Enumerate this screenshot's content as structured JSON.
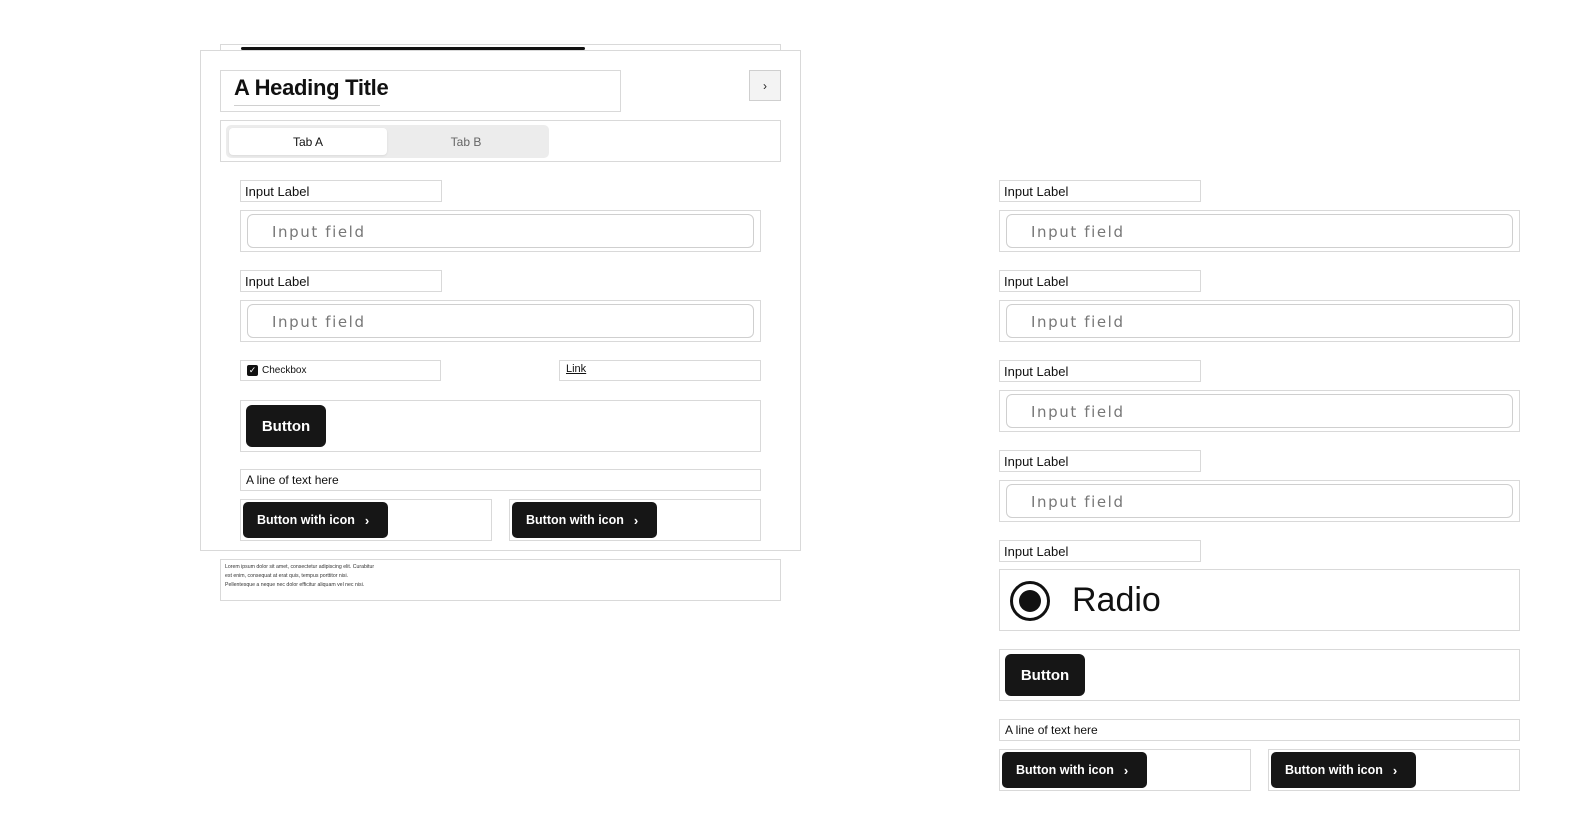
{
  "left_panel": {
    "heading": "A Heading Title",
    "chevron_glyph": "›",
    "tabs": [
      {
        "label": "Tab A",
        "active": true
      },
      {
        "label": "Tab B",
        "active": false
      }
    ],
    "inputs": [
      {
        "label": "Input Label",
        "placeholder": "Input field"
      },
      {
        "label": "Input Label",
        "placeholder": "Input field"
      }
    ],
    "checkbox": {
      "label": "Checkbox",
      "checked": true
    },
    "link": "Link",
    "button": "Button",
    "text_line": "A line of text here",
    "icon_buttons": [
      {
        "label": "Button with icon",
        "icon": "chevron-right-icon"
      },
      {
        "label": "Button with icon",
        "icon": "chevron-right-icon"
      }
    ],
    "lorem": "Lorem ipsum dolor sit amet, consectetur adipiscing elit. Curabitur est enim, consequat at erat quis, tempus porttitor nisi. Pellentesque a neque nec dolor efficitur aliquam vel nec nisi."
  },
  "right_panel": {
    "inputs": [
      {
        "label": "Input Label",
        "placeholder": "Input field"
      },
      {
        "label": "Input Label",
        "placeholder": "Input field"
      },
      {
        "label": "Input Label",
        "placeholder": "Input field"
      },
      {
        "label": "Input Label",
        "placeholder": "Input field"
      }
    ],
    "radio_label_heading": "Input Label",
    "radio": {
      "label": "Radio",
      "selected": true
    },
    "button": "Button",
    "text_line": "A line of text here",
    "icon_buttons": [
      {
        "label": "Button with icon",
        "icon": "chevron-right-icon"
      },
      {
        "label": "Button with icon",
        "icon": "chevron-right-icon"
      }
    ]
  },
  "icons": {
    "chevron": "›",
    "check": "✓"
  },
  "colors": {
    "primary_button": "#161616",
    "border": "#d9d9d9",
    "tab_track": "#ececec"
  }
}
